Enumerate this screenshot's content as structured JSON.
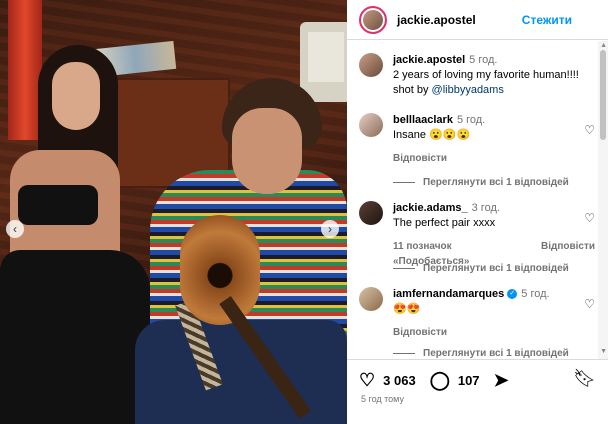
{
  "post": {
    "username": "jackie.apostel",
    "follow_label": "Стежити",
    "caption_time": "5 год.",
    "caption_text": "2 years of loving my favorite human!!!! shot by ",
    "caption_mention": "@libbyyadams",
    "likes": "3 063",
    "comments_count": "107",
    "posted_ago": "5 год тому"
  },
  "comments": [
    {
      "user": "belllaaclark",
      "time": "5 год.",
      "text": "Insane 😮😮😮",
      "reply_label": "Відповісти",
      "view_replies": "Переглянути всі 1 відповідей"
    },
    {
      "user": "jackie.adams_",
      "time": "3 год.",
      "text": "The perfect pair xxxx",
      "likes_label": "11 позначок «Подобається»",
      "reply_label": "Відповісти",
      "view_replies": "Переглянути всі 1 відповідей"
    },
    {
      "user": "iamfernandamarques",
      "time": "5 год.",
      "text": "😍😍",
      "reply_label": "Відповісти",
      "view_replies": "Переглянути всі 1 відповідей"
    }
  ],
  "icons": {
    "heart": "heart-icon",
    "comment": "comment-icon",
    "share": "share-icon",
    "bookmark": "bookmark-icon",
    "arrow_left": "chevron-left-icon",
    "arrow_right": "chevron-right-icon"
  },
  "colors": {
    "link_blue": "#0095f6",
    "mention": "#00376b",
    "muted": "#737373"
  }
}
